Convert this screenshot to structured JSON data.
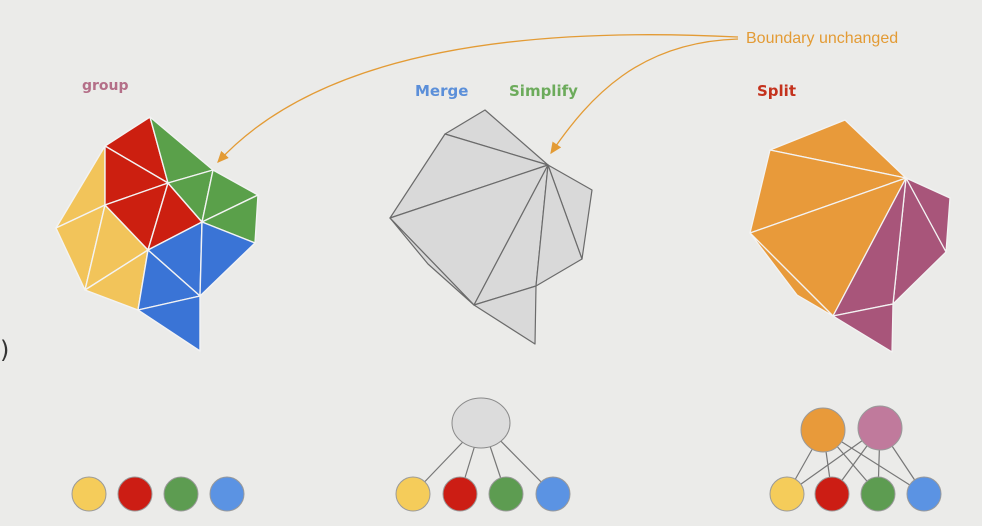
{
  "labels": {
    "group": "group",
    "merge": "Merge",
    "simplify": "Simplify",
    "split": "Split",
    "boundary": "Boundary unchanged",
    "left_paren": ")"
  },
  "colors": {
    "background": "#ebebe9",
    "yellow": "#f2c45a",
    "red": "#cc1f10",
    "green": "#5aa04a",
    "blue": "#3a74d6",
    "gray": "#d9d9d9",
    "orange": "#e89a3a",
    "plum": "#a8557a",
    "group_label": "#b46f88",
    "merge_label": "#5b8fd9",
    "simplify_label": "#6cab5b",
    "split_label": "#c4321d",
    "boundary_label": "#e39b35",
    "arrow": "#e39b35",
    "mesh_line": "#f3f3f3",
    "gray_line": "#6b6b6b",
    "node_yellow": "#f5cc5a",
    "node_red": "#cc1d14",
    "node_green": "#5d9c51",
    "node_blue": "#5b93e3",
    "node_gray": "#dcdcdc",
    "node_orange": "#e89a3a",
    "node_pink": "#c07a9c"
  },
  "graphs": {
    "group": {
      "children": [
        "yellow",
        "red",
        "green",
        "blue"
      ],
      "parents": []
    },
    "merge": {
      "children": [
        "yellow",
        "red",
        "green",
        "blue"
      ],
      "parents": [
        "gray"
      ]
    },
    "split": {
      "children": [
        "yellow",
        "red",
        "green",
        "blue"
      ],
      "parents": [
        "orange",
        "pink"
      ]
    }
  }
}
